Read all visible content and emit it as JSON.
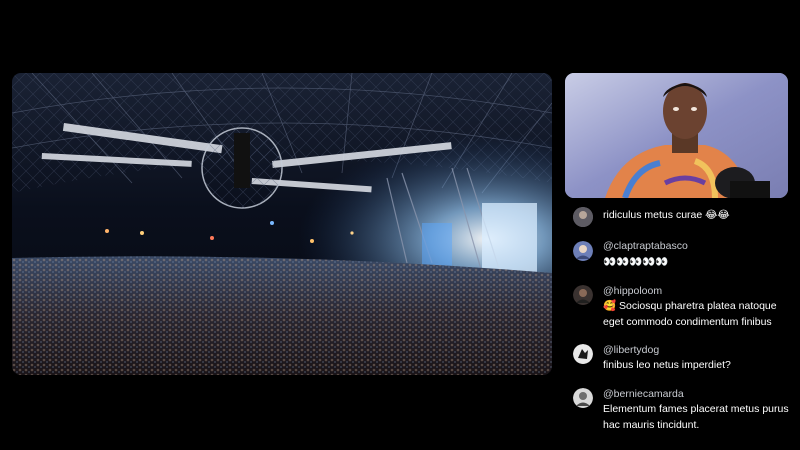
{
  "stage": {
    "image": "concert-arena-crowd-image"
  },
  "camera": {
    "image": "streamer-webcam-image"
  },
  "chat": {
    "messages": [
      {
        "handle": "",
        "text": "ridiculus metus curae 😂😂",
        "avatar_icon": "avatar-icon"
      },
      {
        "handle": "@claptraptabasco",
        "text": "👀👀👀👀👀",
        "avatar_icon": "avatar-icon"
      },
      {
        "handle": "@hippoloom",
        "text": "🥰 Sociosqu pharetra platea natoque eget commodo condimentum finibus",
        "avatar_icon": "avatar-icon"
      },
      {
        "handle": "@libertydog",
        "text": "finibus leo netus imperdiet?",
        "avatar_icon": "avatar-icon"
      },
      {
        "handle": "@berniecamarda",
        "text": "Elementum fames placerat metus purus hac mauris tincidunt.",
        "avatar_icon": "avatar-icon"
      }
    ]
  },
  "colors": {
    "background": "#000000",
    "handle": "#c9ccd2",
    "message_text": "#ffffff"
  }
}
